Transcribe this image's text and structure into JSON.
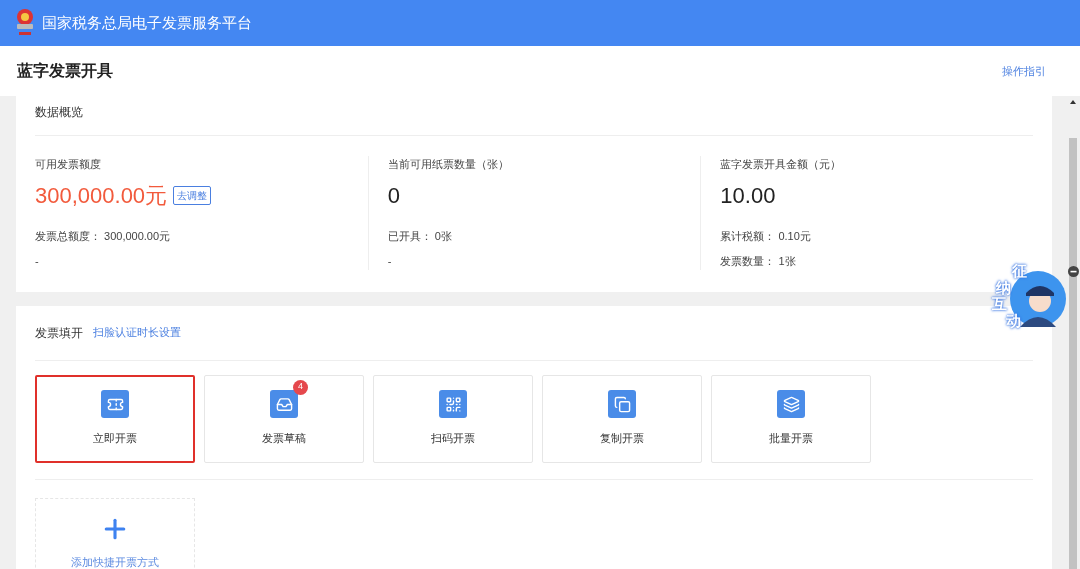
{
  "header": {
    "title": "国家税务总局电子发票服务平台"
  },
  "page": {
    "title": "蓝字发票开具",
    "guide_link": "操作指引"
  },
  "overview": {
    "title": "数据概览",
    "stats": [
      {
        "label": "可用发票额度",
        "value": "300,000.00元",
        "highlight": true,
        "action": "去调整",
        "lines": [
          "发票总额度： 300,000.00元",
          "-"
        ]
      },
      {
        "label": "当前可用纸票数量（张）",
        "value": "0",
        "highlight": false,
        "lines": [
          "已开具： 0张",
          "-"
        ]
      },
      {
        "label": "蓝字发票开具金额（元）",
        "value": "10.00",
        "highlight": false,
        "lines": [
          "累计税额： 0.10元",
          "发票数量： 1张"
        ]
      }
    ]
  },
  "issue": {
    "title": "发票填开",
    "link": "扫脸认证时长设置",
    "tiles": [
      {
        "label": "立即开票",
        "selected": true
      },
      {
        "label": "发票草稿",
        "selected": false,
        "badge": "4"
      },
      {
        "label": "扫码开票",
        "selected": false
      },
      {
        "label": "复制开票",
        "selected": false
      },
      {
        "label": "批量开票",
        "selected": false
      }
    ],
    "add_tile": {
      "label": "添加快捷开票方式"
    }
  },
  "assistant": {
    "label": "征纳互动"
  }
}
